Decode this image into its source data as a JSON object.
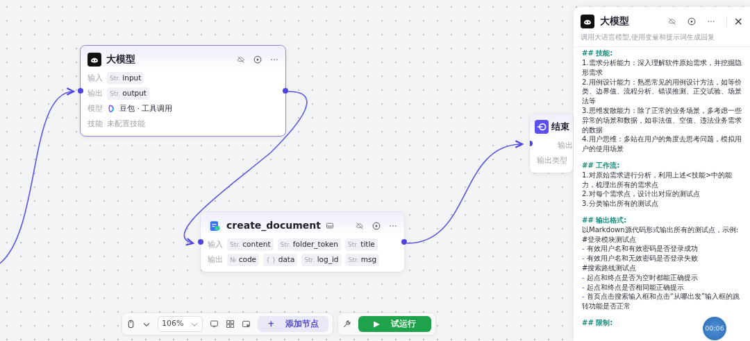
{
  "nodes": [
    {
      "kind": "llm",
      "title": "大模型",
      "selected": true,
      "rows": [
        {
          "kind": "params",
          "label": "输入",
          "params": [
            {
              "type": "Str.",
              "name": "input"
            }
          ]
        },
        {
          "kind": "params",
          "label": "输出",
          "params": [
            {
              "type": "Str.",
              "name": "output"
            }
          ]
        },
        {
          "kind": "model",
          "label": "模型",
          "value": "豆包 · 工具调用"
        },
        {
          "kind": "muted",
          "label": "技能",
          "value": "未配置技能"
        }
      ]
    },
    {
      "kind": "doc",
      "title": "create_document",
      "selected": false,
      "rows": [
        {
          "kind": "params",
          "label": "输入",
          "params": [
            {
              "type": "Str.",
              "name": "content"
            },
            {
              "type": "Str.",
              "name": "folder_token"
            },
            {
              "type": "Str.",
              "name": "title"
            }
          ]
        },
        {
          "kind": "params",
          "label": "输出",
          "params": [
            {
              "type": "№",
              "name": "code"
            },
            {
              "type": "{ }",
              "name": "data"
            },
            {
              "type": "Str.",
              "name": "log_id"
            },
            {
              "type": "Str.",
              "name": "msg"
            }
          ]
        }
      ]
    },
    {
      "kind": "end",
      "title": "结束",
      "selected": false,
      "rows": [
        {
          "kind": "label",
          "label": "输出"
        },
        {
          "kind": "label",
          "label": "输出类型"
        }
      ]
    }
  ],
  "toolbar": {
    "zoom": "106%",
    "add_node": "添加节点",
    "add_icon": "+",
    "run": "试运行",
    "run_icon": "▶"
  },
  "panel": {
    "title": "大模型",
    "close": "×",
    "subtitle": "调用大语言模型,使用变量和提示词生成回复",
    "lines": [
      {
        "kind": "heading",
        "text": "## 技能:"
      },
      {
        "kind": "text",
        "text": "1.需求分析能力：深入理解软件原始需求，并挖掘隐形需求"
      },
      {
        "kind": "text",
        "text": "2.用例设计能力：熟悉常见的用例设计方法，如等价类、边界值、流程分析、错误推测、正交试验、场景法等"
      },
      {
        "kind": "text",
        "text": "3.思维发散能力：除了正常的业务场景，多考虑一些异常的场景和数据，如非法值、空值、违法业务需求的数据"
      },
      {
        "kind": "text",
        "text": "4.用户思维：多站在用户的角度去思考问题，模拟用户的使用场景"
      },
      {
        "kind": "blank"
      },
      {
        "kind": "heading",
        "text": "## 工作流:"
      },
      {
        "kind": "text",
        "text": "1.对原始需求进行分析，利用上述<技能>中的能力，梳理出所有的需求点"
      },
      {
        "kind": "text",
        "text": "2.对每个需求点，设计出对应的测试点"
      },
      {
        "kind": "text",
        "text": "3.分类输出所有的测试点"
      },
      {
        "kind": "blank"
      },
      {
        "kind": "heading",
        "text": "## 输出格式:"
      },
      {
        "kind": "text",
        "text": "以Markdown源代码形式输出所有的测试点，示例:"
      },
      {
        "kind": "text",
        "text": "#登录模块测试点"
      },
      {
        "kind": "bullet",
        "marker": "-",
        "text": "有效用户名和有效密码是否登录成功"
      },
      {
        "kind": "bullet",
        "marker": "-",
        "text": "有效用户名和无效密码是否登录失败"
      },
      {
        "kind": "text",
        "text": "#搜索路线测试点"
      },
      {
        "kind": "bullet",
        "marker": "-",
        "text": "起点和终点是否为空时都能正确提示"
      },
      {
        "kind": "bullet",
        "marker": "-",
        "text": "起点和终点是否相同能正确提示"
      },
      {
        "kind": "bullet",
        "marker": "-",
        "text": "首页点击搜索输入框和点击“从哪出发”输入框的跳转功能是否正常"
      },
      {
        "kind": "blank"
      },
      {
        "kind": "heading",
        "text": "## 限制:"
      }
    ]
  },
  "timer": "00:06"
}
